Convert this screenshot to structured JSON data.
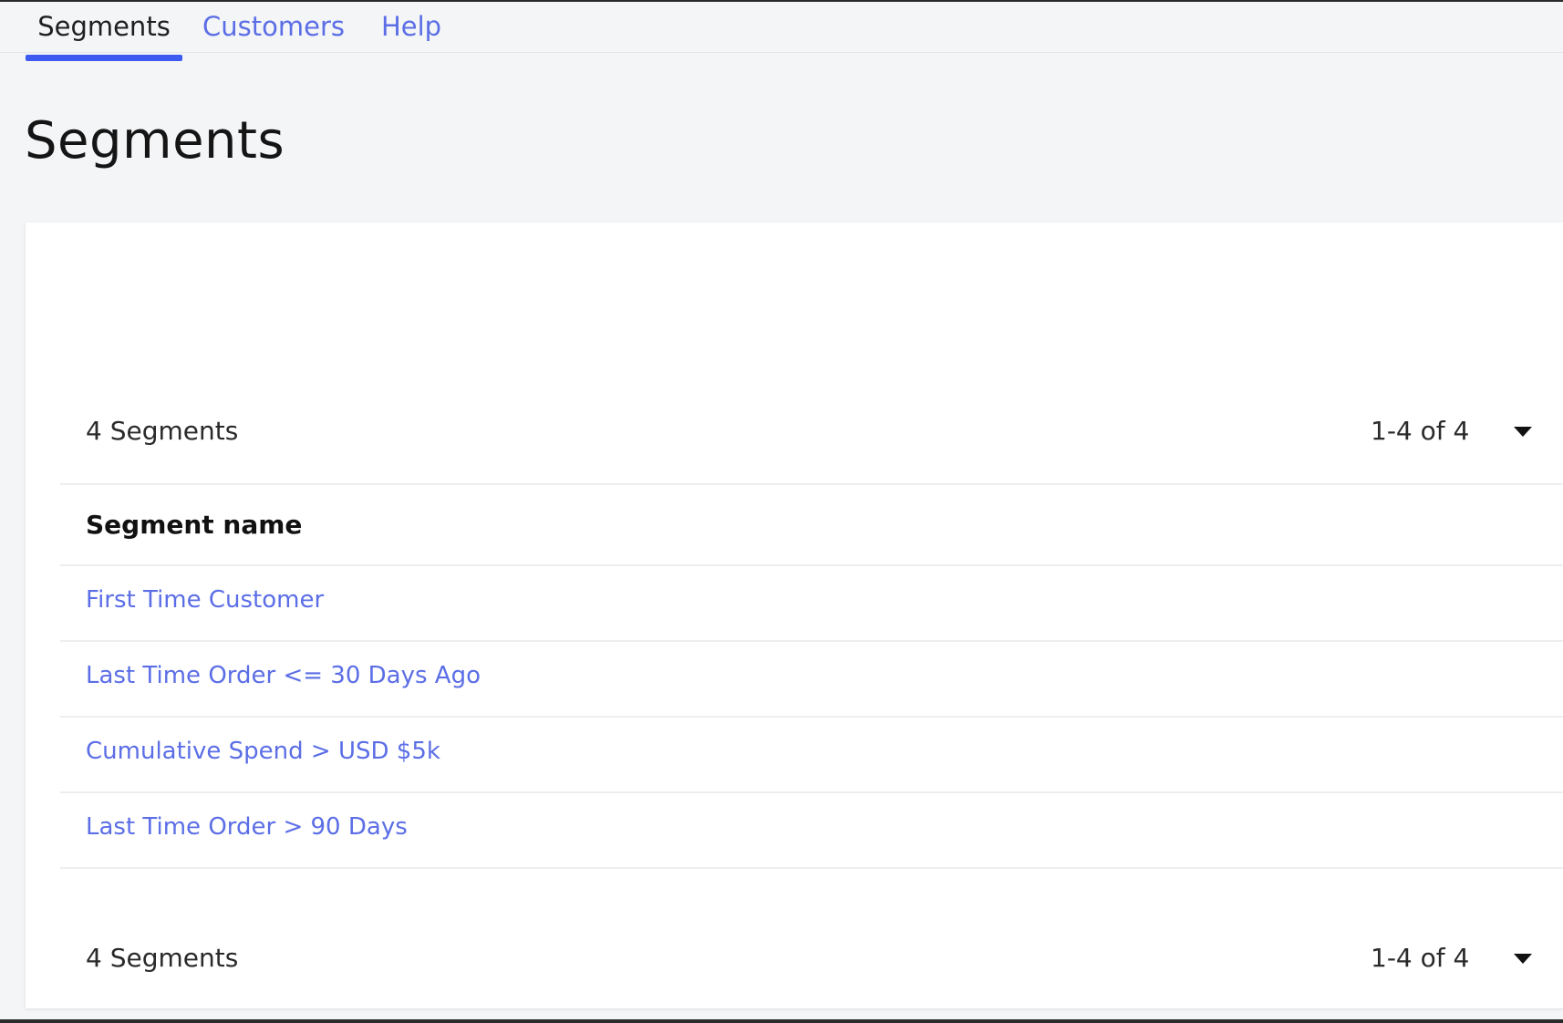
{
  "tabs": [
    {
      "label": "Segments",
      "active": true
    },
    {
      "label": "Customers",
      "active": false
    },
    {
      "label": "Help",
      "active": false
    }
  ],
  "page": {
    "title": "Segments"
  },
  "summary_top": {
    "count_text": "4 Segments",
    "pager_text": "1-4 of 4"
  },
  "table": {
    "column_header": "Segment name",
    "rows": [
      "First Time Customer",
      "Last Time Order <= 30 Days Ago",
      "Cumulative Spend > USD $5k",
      "Last Time Order > 90 Days"
    ]
  },
  "summary_bottom": {
    "count_text": "4 Segments",
    "pager_text": "1-4 of 4"
  },
  "colors": {
    "accent": "#3d5af1",
    "link": "#5b6ee6",
    "background": "#f4f5f7",
    "card": "#ffffff"
  }
}
